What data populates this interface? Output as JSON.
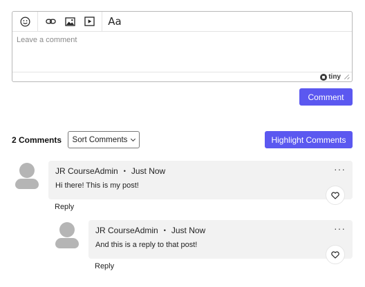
{
  "editor": {
    "placeholder": "Leave a comment",
    "brand": "tiny",
    "aa_label": "Aa",
    "toolbar_icons": [
      "emoji-icon",
      "link-icon",
      "image-icon",
      "media-icon",
      "font-format-icon"
    ]
  },
  "actions": {
    "comment_label": "Comment",
    "highlight_label": "Highlight Comments",
    "sort_label": "Sort Comments"
  },
  "comments_header": {
    "count_label": "2 Comments"
  },
  "comments": [
    {
      "author": "JR CourseAdmin",
      "separator": "•",
      "time": "Just Now",
      "text": "Hi there! This is my post!",
      "reply_label": "Reply",
      "more": "···"
    },
    {
      "author": "JR CourseAdmin",
      "separator": "•",
      "time": "Just Now",
      "text": "And this is a reply to that post!",
      "reply_label": "Reply",
      "more": "···"
    }
  ],
  "colors": {
    "primary": "#5b58f0",
    "card_bg": "#f2f2f2",
    "avatar": "#b5b5b5"
  }
}
